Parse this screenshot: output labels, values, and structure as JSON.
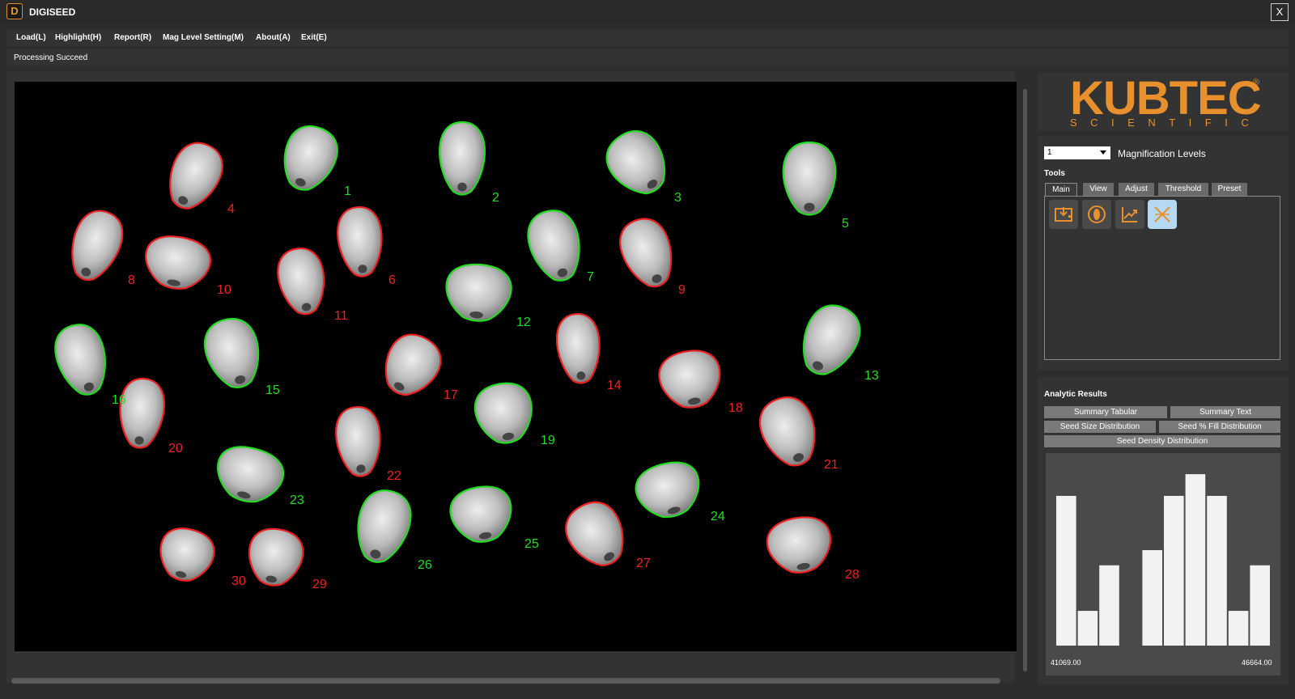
{
  "window": {
    "title": "DIGISEED",
    "logo_glyph": "D",
    "close_label": "X"
  },
  "menu": [
    "Load(L)",
    "Highlight(H)",
    "Report(R)",
    "Mag Level Setting(M)",
    "About(A)",
    "Exit(E)"
  ],
  "status": "Processing Succeed",
  "brand": {
    "name": "KUBTEC",
    "subtitle": "SCIENTIFIC",
    "registered": "®",
    "color": "#e8902e"
  },
  "magnification": {
    "selected": "1",
    "label": "Magnification Levels"
  },
  "tools": {
    "label": "Tools",
    "tabs": [
      "Main",
      "View",
      "Adjust",
      "Threshold",
      "Preset"
    ],
    "active_tab": "Main",
    "buttons": [
      {
        "icon": "load-image-icon"
      },
      {
        "icon": "seed-icon"
      },
      {
        "icon": "chart-line-icon"
      },
      {
        "icon": "crossed-lines-icon",
        "active": true
      }
    ]
  },
  "analytic": {
    "label": "Analytic Results",
    "buttons": [
      "Summary Tabular",
      "Summary Text",
      "Seed Size Distribution",
      "Seed % Fill Distribution",
      "Seed Density Distribution"
    ]
  },
  "seed_colors": {
    "pass": "#22dd22",
    "fail": "#ee2222"
  },
  "seeds": [
    {
      "label": "1",
      "status": "pass"
    },
    {
      "label": "2",
      "status": "pass"
    },
    {
      "label": "3",
      "status": "pass"
    },
    {
      "label": "4",
      "status": "fail"
    },
    {
      "label": "5",
      "status": "pass"
    },
    {
      "label": "6",
      "status": "fail"
    },
    {
      "label": "7",
      "status": "pass"
    },
    {
      "label": "8",
      "status": "fail"
    },
    {
      "label": "9",
      "status": "fail"
    },
    {
      "label": "10",
      "status": "fail"
    },
    {
      "label": "11",
      "status": "fail"
    },
    {
      "label": "12",
      "status": "pass"
    },
    {
      "label": "13",
      "status": "pass"
    },
    {
      "label": "14",
      "status": "fail"
    },
    {
      "label": "15",
      "status": "pass"
    },
    {
      "label": "16",
      "status": "pass"
    },
    {
      "label": "17",
      "status": "fail"
    },
    {
      "label": "18",
      "status": "fail"
    },
    {
      "label": "19",
      "status": "pass"
    },
    {
      "label": "20",
      "status": "fail"
    },
    {
      "label": "21",
      "status": "fail"
    },
    {
      "label": "22",
      "status": "fail"
    },
    {
      "label": "23",
      "status": "pass"
    },
    {
      "label": "24",
      "status": "pass"
    },
    {
      "label": "25",
      "status": "pass"
    },
    {
      "label": "26",
      "status": "pass"
    },
    {
      "label": "27",
      "status": "fail"
    },
    {
      "label": "28",
      "status": "fail"
    },
    {
      "label": "29",
      "status": "fail"
    },
    {
      "label": "30",
      "status": "fail"
    }
  ],
  "chart_data": {
    "type": "bar",
    "title": "",
    "x_min_label": "41069.00",
    "x_max_label": "46664.00",
    "values": [
      0.69,
      0.16,
      0.37,
      0,
      0.44,
      0.69,
      0.79,
      0.69,
      0.16,
      0.37
    ],
    "bar_color": "#f2f2f2"
  }
}
